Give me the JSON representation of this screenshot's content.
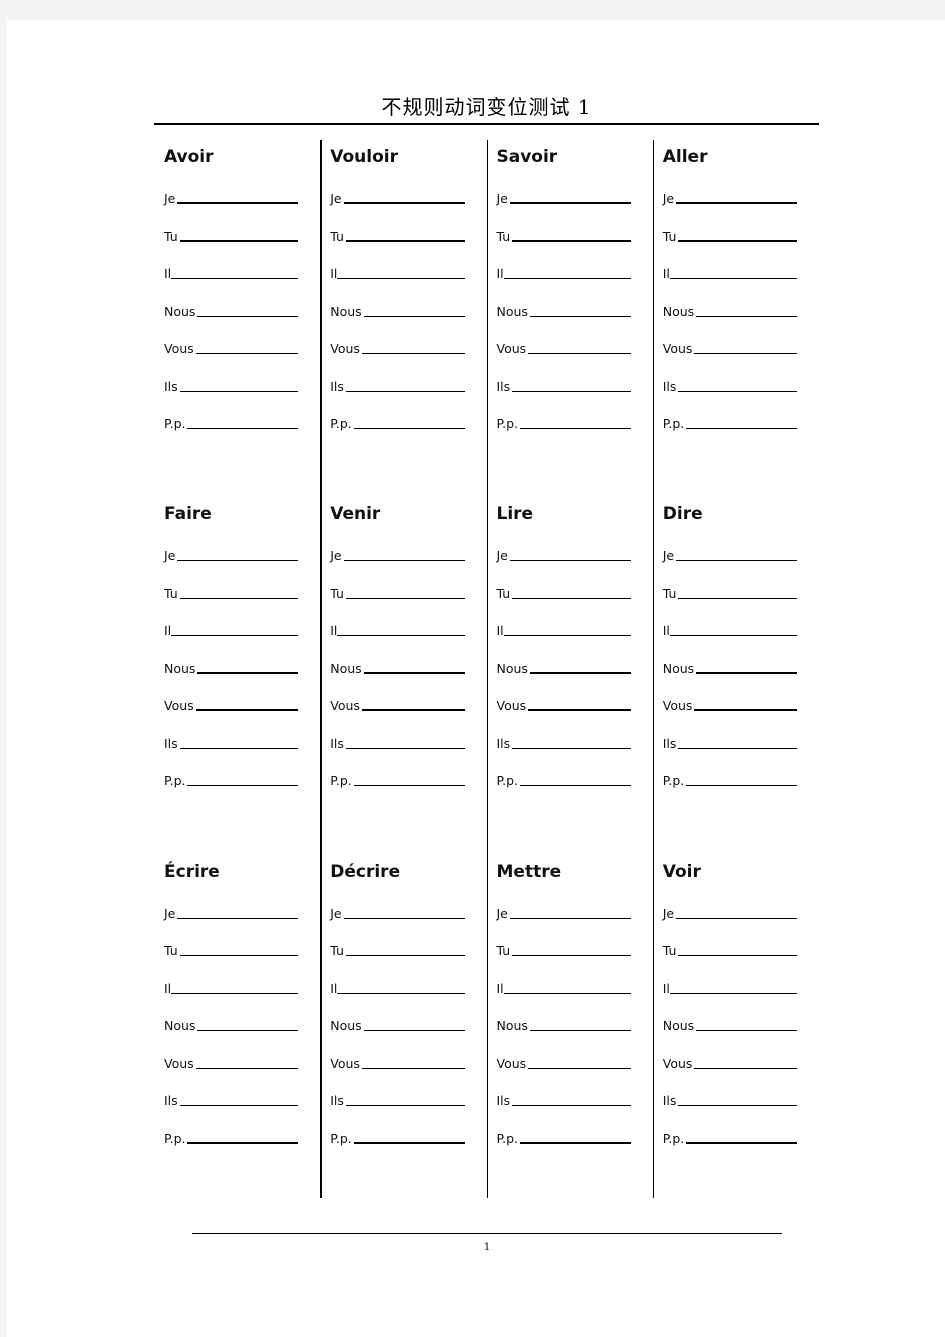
{
  "header": {
    "title": "不规则动词变位测试 1"
  },
  "footer": {
    "page_number": "1"
  },
  "pronoun_labels": [
    "Je",
    "Tu",
    "Il",
    "Nous",
    "Vous",
    "Ils",
    "P.p."
  ],
  "cards": [
    {
      "verb": "Avoir",
      "rows": [
        {
          "pronoun": "Je",
          "weight": "thick"
        },
        {
          "pronoun": "Tu",
          "weight": "thick"
        },
        {
          "pronoun": "Il",
          "weight": "thin"
        },
        {
          "pronoun": "Nous",
          "weight": "thin"
        },
        {
          "pronoun": "Vous",
          "weight": "thin"
        },
        {
          "pronoun": "Ils",
          "weight": "thin"
        },
        {
          "pronoun": "P.p.",
          "weight": "thin"
        }
      ]
    },
    {
      "verb": "Vouloir",
      "rows": [
        {
          "pronoun": "Je",
          "weight": "thick"
        },
        {
          "pronoun": "Tu",
          "weight": "thick"
        },
        {
          "pronoun": "Il",
          "weight": "thin"
        },
        {
          "pronoun": "Nous",
          "weight": "thin"
        },
        {
          "pronoun": "Vous",
          "weight": "thin"
        },
        {
          "pronoun": "Ils",
          "weight": "thin"
        },
        {
          "pronoun": "P.p.",
          "weight": "thin"
        }
      ]
    },
    {
      "verb": "Savoir",
      "rows": [
        {
          "pronoun": "Je",
          "weight": "thick"
        },
        {
          "pronoun": "Tu",
          "weight": "thick"
        },
        {
          "pronoun": "Il",
          "weight": "thin"
        },
        {
          "pronoun": "Nous",
          "weight": "thin"
        },
        {
          "pronoun": "Vous",
          "weight": "thin"
        },
        {
          "pronoun": "Ils",
          "weight": "thin"
        },
        {
          "pronoun": "P.p.",
          "weight": "thin"
        }
      ]
    },
    {
      "verb": "Aller",
      "rows": [
        {
          "pronoun": "Je",
          "weight": "thick"
        },
        {
          "pronoun": "Tu",
          "weight": "thick"
        },
        {
          "pronoun": "Il",
          "weight": "thin"
        },
        {
          "pronoun": "Nous",
          "weight": "thin"
        },
        {
          "pronoun": "Vous",
          "weight": "thin"
        },
        {
          "pronoun": "Ils",
          "weight": "thin"
        },
        {
          "pronoun": "P.p.",
          "weight": "thin"
        }
      ]
    },
    {
      "verb": "Faire",
      "rows": [
        {
          "pronoun": "Je",
          "weight": "thin"
        },
        {
          "pronoun": "Tu",
          "weight": "thin"
        },
        {
          "pronoun": "Il",
          "weight": "thin"
        },
        {
          "pronoun": "Nous",
          "weight": "thick"
        },
        {
          "pronoun": "Vous",
          "weight": "thick"
        },
        {
          "pronoun": "Ils",
          "weight": "thin"
        },
        {
          "pronoun": "P.p.",
          "weight": "thin"
        }
      ]
    },
    {
      "verb": "Venir",
      "rows": [
        {
          "pronoun": "Je",
          "weight": "thin"
        },
        {
          "pronoun": "Tu",
          "weight": "thin"
        },
        {
          "pronoun": "Il",
          "weight": "thin"
        },
        {
          "pronoun": "Nous",
          "weight": "thick"
        },
        {
          "pronoun": "Vous",
          "weight": "thick"
        },
        {
          "pronoun": "Ils",
          "weight": "thin"
        },
        {
          "pronoun": "P.p.",
          "weight": "thin"
        }
      ]
    },
    {
      "verb": "Lire",
      "rows": [
        {
          "pronoun": "Je",
          "weight": "thin"
        },
        {
          "pronoun": "Tu",
          "weight": "thin"
        },
        {
          "pronoun": "Il",
          "weight": "thin"
        },
        {
          "pronoun": "Nous",
          "weight": "thick"
        },
        {
          "pronoun": "Vous",
          "weight": "thick"
        },
        {
          "pronoun": "Ils",
          "weight": "thin"
        },
        {
          "pronoun": "P.p.",
          "weight": "thin"
        }
      ]
    },
    {
      "verb": "Dire",
      "rows": [
        {
          "pronoun": "Je",
          "weight": "thin"
        },
        {
          "pronoun": "Tu",
          "weight": "thin"
        },
        {
          "pronoun": "Il",
          "weight": "thin"
        },
        {
          "pronoun": "Nous",
          "weight": "thick"
        },
        {
          "pronoun": "Vous",
          "weight": "thick"
        },
        {
          "pronoun": "Ils",
          "weight": "thin"
        },
        {
          "pronoun": "P.p.",
          "weight": "thin"
        }
      ]
    },
    {
      "verb": "Écrire",
      "rows": [
        {
          "pronoun": "Je",
          "weight": "thin"
        },
        {
          "pronoun": "Tu",
          "weight": "thin"
        },
        {
          "pronoun": "Il",
          "weight": "thin"
        },
        {
          "pronoun": "Nous",
          "weight": "thin"
        },
        {
          "pronoun": "Vous",
          "weight": "thin"
        },
        {
          "pronoun": "Ils",
          "weight": "thin"
        },
        {
          "pronoun": "P.p.",
          "weight": "thick"
        }
      ]
    },
    {
      "verb": "Décrire",
      "rows": [
        {
          "pronoun": "Je",
          "weight": "thin"
        },
        {
          "pronoun": "Tu",
          "weight": "thin"
        },
        {
          "pronoun": "Il",
          "weight": "thin"
        },
        {
          "pronoun": "Nous",
          "weight": "thin"
        },
        {
          "pronoun": "Vous",
          "weight": "thin"
        },
        {
          "pronoun": "Ils",
          "weight": "thin"
        },
        {
          "pronoun": "P.p.",
          "weight": "thick"
        }
      ]
    },
    {
      "verb": "Mettre",
      "rows": [
        {
          "pronoun": "Je",
          "weight": "thin"
        },
        {
          "pronoun": "Tu",
          "weight": "thin"
        },
        {
          "pronoun": "Il",
          "weight": "thin"
        },
        {
          "pronoun": "Nous",
          "weight": "thin"
        },
        {
          "pronoun": "Vous",
          "weight": "thin"
        },
        {
          "pronoun": "Ils",
          "weight": "thin"
        },
        {
          "pronoun": "P.p.",
          "weight": "thick"
        }
      ]
    },
    {
      "verb": "Voir",
      "rows": [
        {
          "pronoun": "Je",
          "weight": "thin"
        },
        {
          "pronoun": "Tu",
          "weight": "thin"
        },
        {
          "pronoun": "Il",
          "weight": "thin"
        },
        {
          "pronoun": "Nous",
          "weight": "thin"
        },
        {
          "pronoun": "Vous",
          "weight": "thin"
        },
        {
          "pronoun": "Ils",
          "weight": "thin"
        },
        {
          "pronoun": "P.p.",
          "weight": "thick"
        }
      ]
    }
  ]
}
